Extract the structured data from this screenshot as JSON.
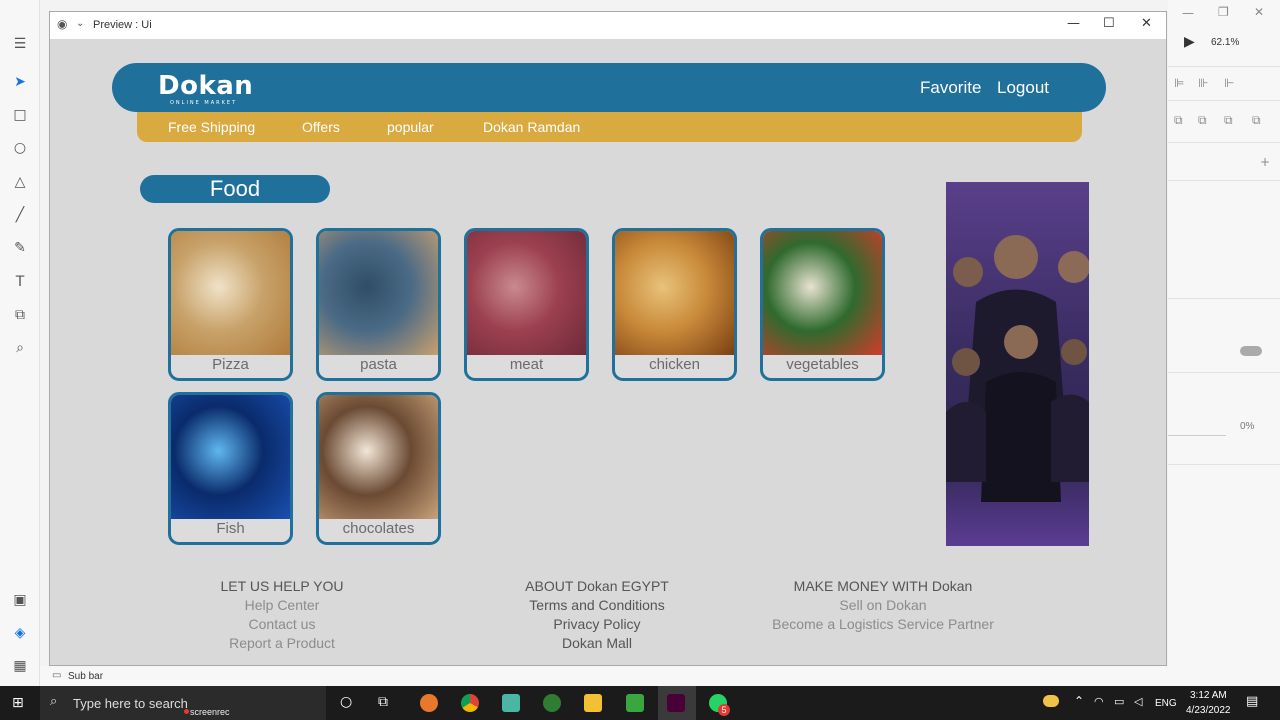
{
  "window": {
    "title": "Preview : Ui"
  },
  "xd": {
    "zoom": "62.1%",
    "opacity": "0%",
    "layer_name": "Sub bar"
  },
  "header": {
    "logo": "Dokan",
    "logo_sub": "ONLINE MARKET",
    "favorite": "Favorite",
    "logout": "Logout"
  },
  "subbar": {
    "items": [
      "Free Shipping",
      "Offers",
      "popular",
      "Dokan Ramdan"
    ]
  },
  "section": {
    "title": "Food"
  },
  "categories": [
    {
      "label": "Pizza",
      "colors": [
        "#c8a26a",
        "#b07a3a",
        "#f0e2c8"
      ]
    },
    {
      "label": "pasta",
      "colors": [
        "#4a6a86",
        "#c8a070",
        "#2f4d66"
      ]
    },
    {
      "label": "meat",
      "colors": [
        "#9c4050",
        "#6e2a38",
        "#c98a8f"
      ]
    },
    {
      "label": "chicken",
      "colors": [
        "#c98a3a",
        "#7a3f12",
        "#e8c27a"
      ]
    },
    {
      "label": "vegetables",
      "colors": [
        "#2f6a2e",
        "#d23b2b",
        "#e8e2d0"
      ]
    },
    {
      "label": "Fish",
      "colors": [
        "#0a2b6b",
        "#1a4fb0",
        "#5fb7f0"
      ]
    },
    {
      "label": "chocolates",
      "colors": [
        "#6b4a33",
        "#c9a27a",
        "#f2e6d6"
      ]
    }
  ],
  "footer": {
    "help": {
      "title": "LET US HELP YOU",
      "links": [
        "Help Center",
        "Contact us",
        "Report a Product"
      ]
    },
    "about": {
      "title": "ABOUT Dokan EGYPT",
      "links": [
        "Terms and Conditions",
        "Privacy Policy",
        "Dokan Mall"
      ]
    },
    "money": {
      "title": "MAKE MONEY WITH Dokan",
      "links": [
        "Sell on Dokan",
        "Become a Logistics Service Partner"
      ]
    }
  },
  "taskbar": {
    "search_placeholder": "Type here to search",
    "lang": "ENG",
    "time": "3:12 AM",
    "date": "4/23/2022",
    "badge": "5",
    "screenrec": "screenrec"
  },
  "colors": {
    "brand_blue": "#20709c",
    "brand_gold": "#d8aa3f"
  }
}
